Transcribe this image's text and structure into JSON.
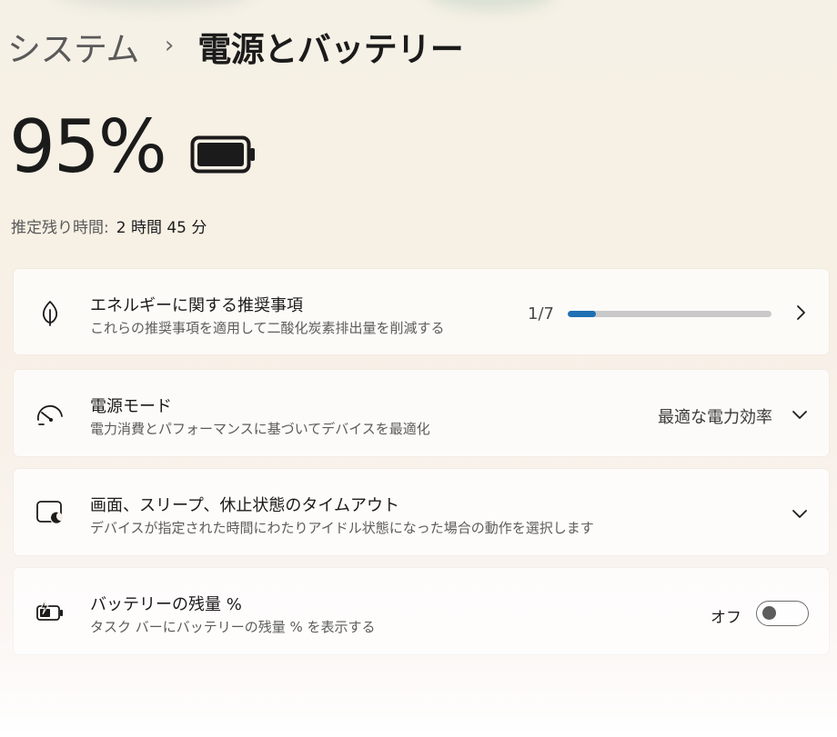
{
  "breadcrumb": {
    "parent": "システム",
    "separator": "›",
    "current": "電源とバッテリー"
  },
  "battery": {
    "percent_label": "95%",
    "percent_value": 95,
    "estimate_label": "推定残り時間:",
    "estimate_value": "2 時間 45 分"
  },
  "cards": {
    "energy": {
      "icon": "leaf-icon",
      "title": "エネルギーに関する推奨事項",
      "description": "これらの推奨事項を適用して二酸化炭素排出量を削減する",
      "progress_label": "1/7",
      "progress_fraction": 0.14,
      "accent_color": "#1f6fb3"
    },
    "power_mode": {
      "icon": "speedometer-icon",
      "title": "電源モード",
      "description": "電力消費とパフォーマンスに基づいてデバイスを最適化",
      "selected_value": "最適な電力効率"
    },
    "screen_sleep": {
      "icon": "screen-sleep-icon",
      "title": "画面、スリープ、休止状態のタイムアウト",
      "description": "デバイスが指定された時間にわたりアイドル状態になった場合の動作を選択します"
    },
    "battery_percent": {
      "icon": "battery-charging-icon",
      "title": "バッテリーの残量 %",
      "description": "タスク バーにバッテリーの残量 % を表示する",
      "toggle_label": "オフ",
      "toggle_on": false
    }
  }
}
